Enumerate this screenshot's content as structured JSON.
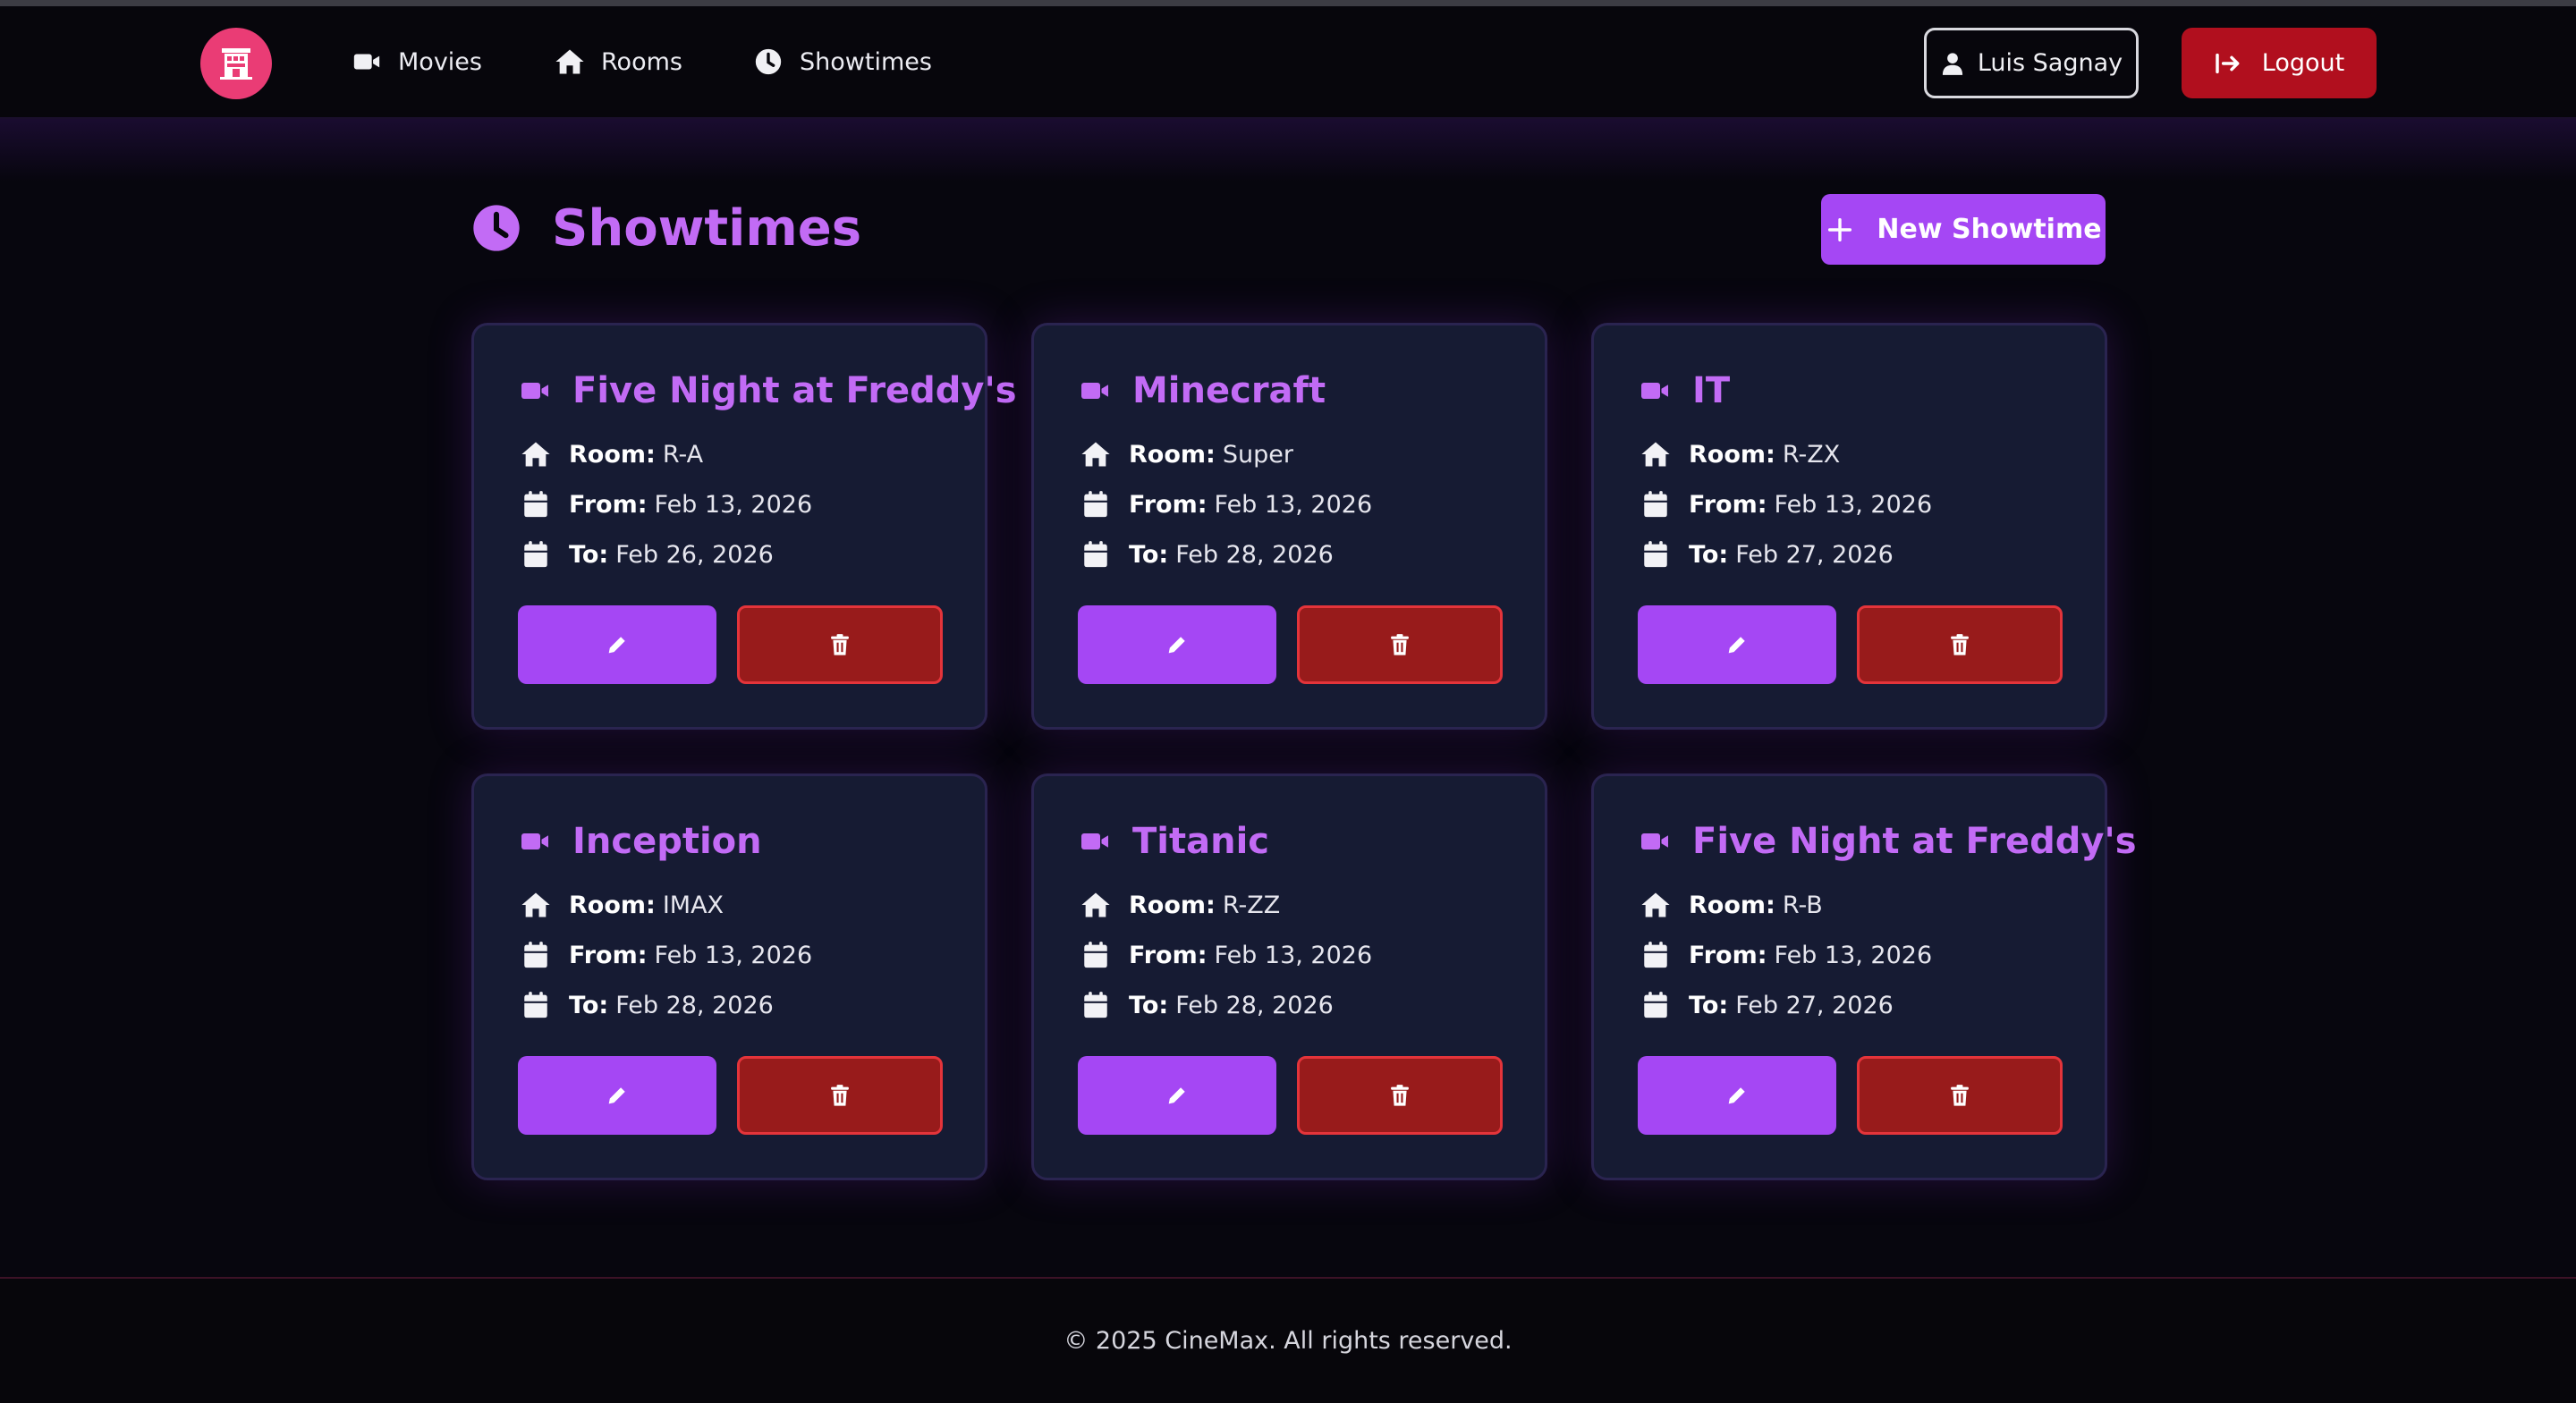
{
  "nav": {
    "links": [
      {
        "label": "Movies",
        "icon": "video-icon"
      },
      {
        "label": "Rooms",
        "icon": "home-icon"
      },
      {
        "label": "Showtimes",
        "icon": "clock-icon"
      }
    ],
    "user": "Luis Sagnay",
    "logout": "Logout"
  },
  "page": {
    "title": "Showtimes",
    "new_button": "New Showtime"
  },
  "labels": {
    "room": "Room:",
    "from": "From:",
    "to": "To:"
  },
  "showtimes": [
    {
      "movie": "Five Night at Freddy's",
      "room": "R-A",
      "from": "Feb 13, 2026",
      "to": "Feb 26, 2026"
    },
    {
      "movie": "Minecraft",
      "room": "Super",
      "from": "Feb 13, 2026",
      "to": "Feb 28, 2026"
    },
    {
      "movie": "IT",
      "room": "R-ZX",
      "from": "Feb 13, 2026",
      "to": "Feb 27, 2026"
    },
    {
      "movie": "Inception",
      "room": "IMAX",
      "from": "Feb 13, 2026",
      "to": "Feb 28, 2026"
    },
    {
      "movie": "Titanic",
      "room": "R-ZZ",
      "from": "Feb 13, 2026",
      "to": "Feb 28, 2026"
    },
    {
      "movie": "Five Night at Freddy's",
      "room": "R-B",
      "from": "Feb 13, 2026",
      "to": "Feb 27, 2026"
    }
  ],
  "footer": "© 2025 CineMax. All rights reserved.",
  "colors": {
    "accent": "#a547f4",
    "title_purple": "#c26bf5",
    "danger": "#b10f1e",
    "card_bg": "#161b33",
    "logo_pink": "#ea3c75"
  }
}
